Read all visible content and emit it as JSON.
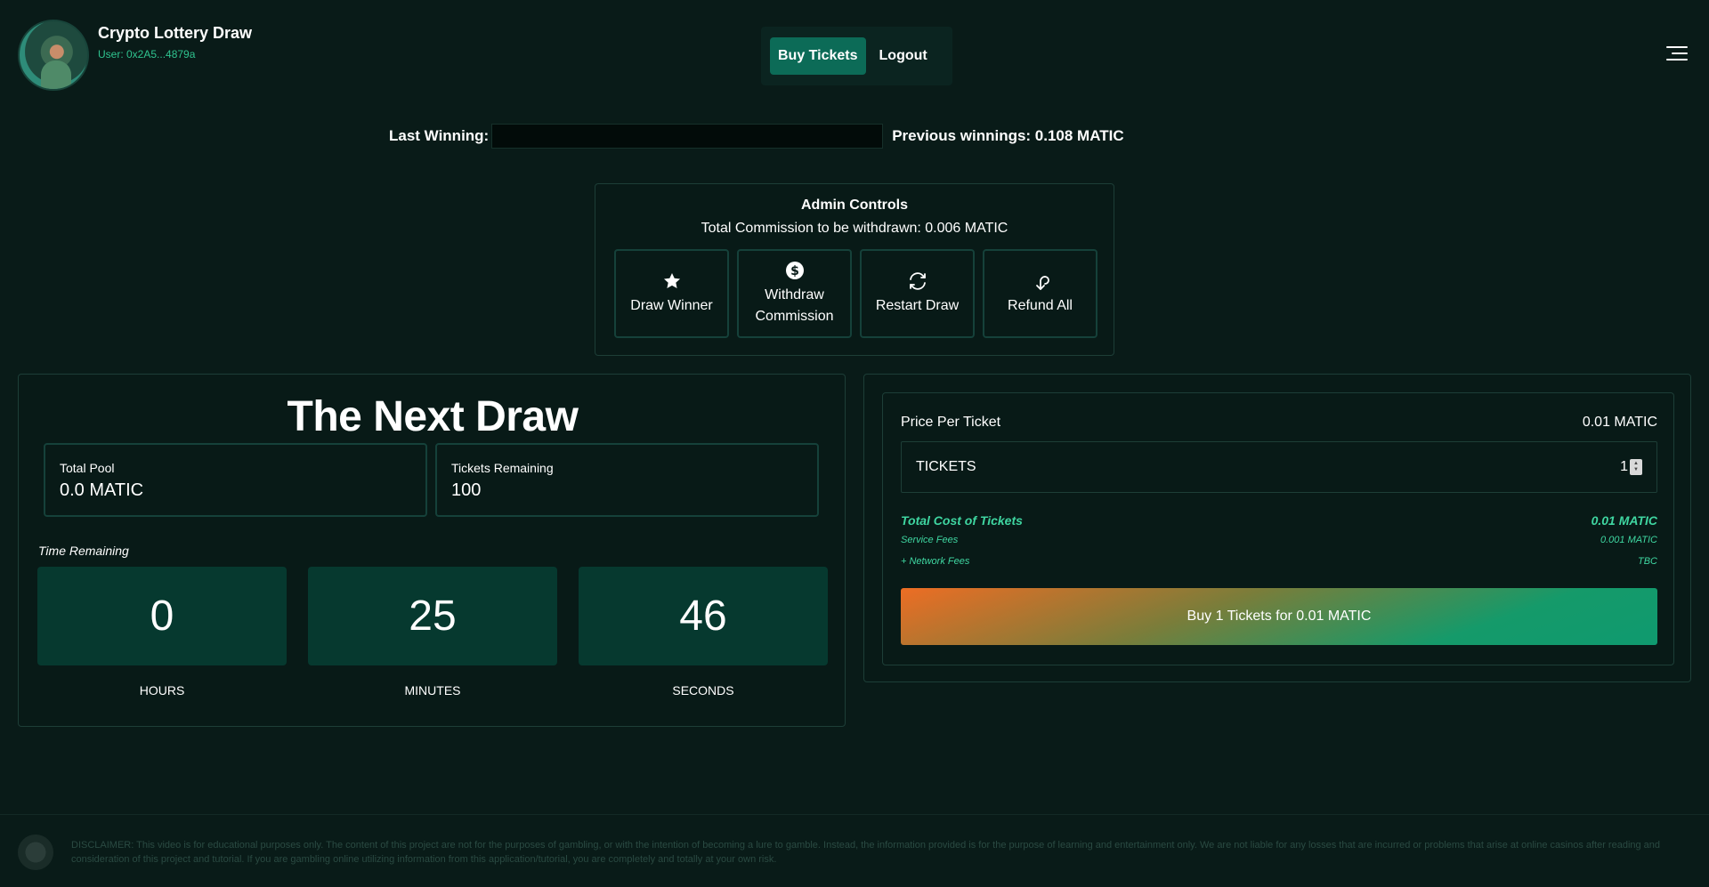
{
  "header": {
    "title": "Crypto Lottery Draw",
    "user": "User: 0x2A5...4879a",
    "nav": {
      "buy": "Buy Tickets",
      "logout": "Logout"
    }
  },
  "last_winning": {
    "label": "Last Winning:",
    "previous": "Previous winnings: 0.108 MATIC"
  },
  "admin": {
    "title": "Admin Controls",
    "commission": "Total Commission to be withdrawn: 0.006 MATIC",
    "buttons": {
      "draw": "Draw Winner",
      "withdraw": "Withdraw Commission",
      "restart": "Restart Draw",
      "refund": "Refund All"
    }
  },
  "next_draw": {
    "title": "The Next Draw",
    "pool_label": "Total Pool",
    "pool_value": "0.0 MATIC",
    "remaining_label": "Tickets Remaining",
    "remaining_value": "100",
    "time_label": "Time Remaining",
    "hours": "0",
    "minutes": "25",
    "seconds": "46",
    "hours_label": "HOURS",
    "minutes_label": "MINUTES",
    "seconds_label": "SECONDS"
  },
  "ticket": {
    "price_label": "Price Per Ticket",
    "price_value": "0.01 MATIC",
    "input_label": "TICKETS",
    "quantity": "1",
    "total_label": "Total Cost of Tickets",
    "total_value": "0.01 MATIC",
    "service_label": "Service Fees",
    "service_value": "0.001 MATIC",
    "network_label": "+ Network Fees",
    "network_value": "TBC",
    "buy_button": "Buy 1 Tickets for 0.01 MATIC"
  },
  "footer": {
    "disclaimer": "DISCLAIMER: This video is for educational purposes only. The content of this project are not for the purposes of gambling, or with the intention of becoming a lure to gamble. Instead, the information provided is for the purpose of learning and entertainment only. We are not liable for any losses that are incurred or problems that arise at online casinos after reading and consideration of this project and tutorial. If you are gambling online utilizing information from this application/tutorial, you are completely and totally at your own risk."
  },
  "colors": {
    "background": "#091b18",
    "accent": "#0c6b57",
    "highlight": "#3fd6a1",
    "countdown_bg": "#06392f"
  }
}
